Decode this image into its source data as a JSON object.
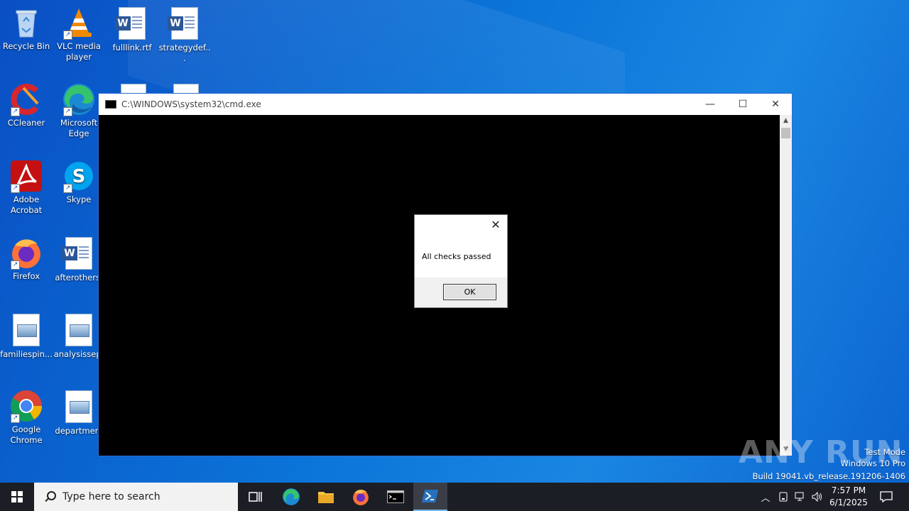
{
  "desktop": {
    "icons": [
      {
        "label": "Recycle Bin",
        "icon": "recycle-bin-icon"
      },
      {
        "label": "VLC media player",
        "icon": "vlc-icon"
      },
      {
        "label": "fulllink.rtf",
        "icon": "word-doc-icon"
      },
      {
        "label": "strategydef...",
        "icon": "word-doc-icon"
      },
      {
        "label": "CCleaner",
        "icon": "ccleaner-icon"
      },
      {
        "label": "Microsoft Edge",
        "icon": "edge-icon"
      },
      {
        "label": "Adobe Acrobat",
        "icon": "acrobat-icon"
      },
      {
        "label": "Skype",
        "icon": "skype-icon"
      },
      {
        "label": "Firefox",
        "icon": "firefox-icon"
      },
      {
        "label": "afterothers.",
        "icon": "word-doc-icon"
      },
      {
        "label": "familiespin...",
        "icon": "image-file-icon"
      },
      {
        "label": "analysissep.",
        "icon": "image-file-icon"
      },
      {
        "label": "Google Chrome",
        "icon": "chrome-icon"
      },
      {
        "label": "departmen.",
        "icon": "image-file-icon"
      }
    ]
  },
  "cmd_window": {
    "title": "C:\\WINDOWS\\system32\\cmd.exe",
    "minimize": "—",
    "maximize": "☐",
    "close": "✕"
  },
  "message_box": {
    "text": "All checks passed",
    "ok_label": "OK",
    "close": "✕"
  },
  "watermark": {
    "logo": "ANY RUN",
    "mode": "Test Mode",
    "edition": "Windows 10 Pro",
    "build": "Build 19041.vb_release.191206-1406"
  },
  "taskbar": {
    "search_placeholder": "Type here to search",
    "time": "7:57 PM",
    "date": "6/1/2025"
  },
  "colors": {
    "desktop_bg": "#0b74d8",
    "taskbar_bg": "#1c1e26",
    "active_indicator": "#76b9ed"
  }
}
